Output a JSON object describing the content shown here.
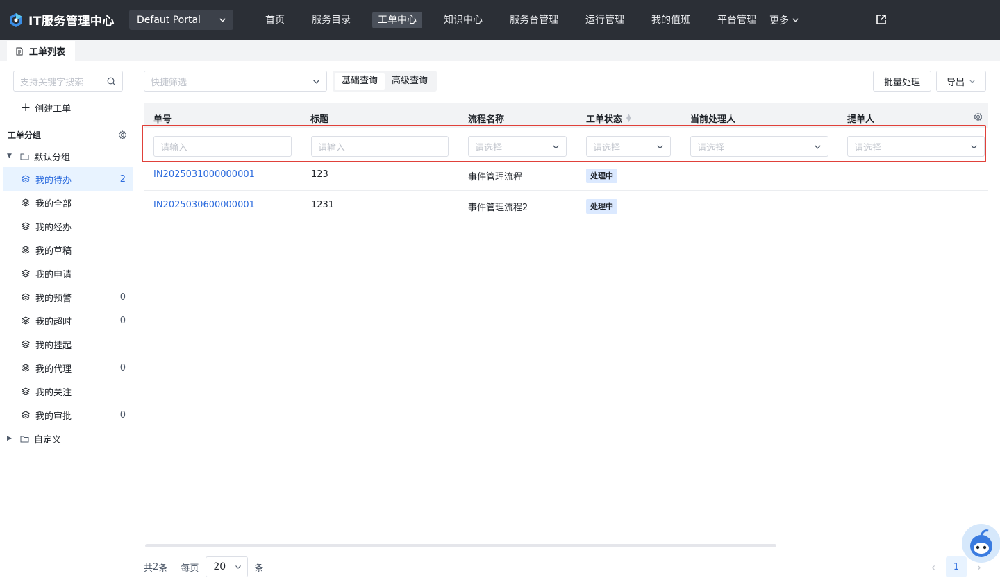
{
  "app": {
    "title": "IT服务管理中心"
  },
  "portal": {
    "label": "Defaut Portal"
  },
  "nav": {
    "items": [
      {
        "label": "首页"
      },
      {
        "label": "服务目录"
      },
      {
        "label": "工单中心"
      },
      {
        "label": "知识中心"
      },
      {
        "label": "服务台管理"
      },
      {
        "label": "运行管理"
      },
      {
        "label": "我的值班"
      },
      {
        "label": "平台管理"
      }
    ],
    "active": "工单中心",
    "more_label": "更多"
  },
  "tab": {
    "label": "工单列表"
  },
  "sidebar": {
    "search_placeholder": "支持关键字搜索",
    "create_label": "创建工单",
    "group_title": "工单分组",
    "default_group": "默认分组",
    "custom_group": "自定义",
    "items": [
      {
        "label": "我的待办",
        "count": "2",
        "active": true
      },
      {
        "label": "我的全部",
        "count": ""
      },
      {
        "label": "我的经办",
        "count": ""
      },
      {
        "label": "我的草稿",
        "count": ""
      },
      {
        "label": "我的申请",
        "count": ""
      },
      {
        "label": "我的预警",
        "count": "0"
      },
      {
        "label": "我的超时",
        "count": "0"
      },
      {
        "label": "我的挂起",
        "count": ""
      },
      {
        "label": "我的代理",
        "count": "0"
      },
      {
        "label": "我的关注",
        "count": ""
      },
      {
        "label": "我的审批",
        "count": "0"
      }
    ]
  },
  "toolbar": {
    "quick_filter_placeholder": "快捷筛选",
    "basic_query": "基础查询",
    "advanced_query": "高级查询",
    "batch_label": "批量处理",
    "export_label": "导出"
  },
  "table": {
    "columns": [
      "单号",
      "标题",
      "流程名称",
      "工单状态",
      "当前处理人",
      "提单人"
    ],
    "filters": {
      "input_placeholder": "请输入",
      "select_placeholder": "请选择"
    },
    "rows": [
      {
        "id": "IN2025031000000001",
        "title": "123",
        "process": "事件管理流程",
        "status": "处理中"
      },
      {
        "id": "IN2025030600000001",
        "title": "1231",
        "process": "事件管理流程2",
        "status": "处理中"
      }
    ]
  },
  "pagination": {
    "total_prefix": "共",
    "total": "2",
    "total_suffix": "条",
    "per_page_label": "每页",
    "page_size": "20",
    "unit": "条",
    "current_page": "1"
  },
  "colors": {
    "topbar": "#2b2f36",
    "accent": "#2d6cde",
    "highlight_border": "#e0413a",
    "status_badge_bg": "#dbe9ff"
  }
}
